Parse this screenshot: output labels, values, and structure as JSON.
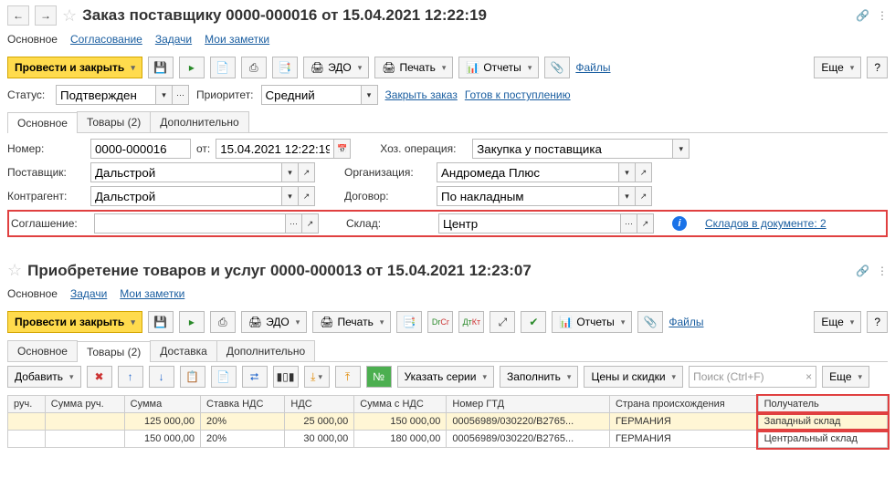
{
  "doc1": {
    "title": "Заказ поставщику 0000-000016 от 15.04.2021 12:22:19",
    "navTabs": {
      "main": "Основное",
      "approval": "Согласование",
      "tasks": "Задачи",
      "notes": "Мои заметки"
    },
    "toolbar": {
      "postClose": "Провести и закрыть",
      "edo": "ЭДО",
      "print": "Печать",
      "reports": "Отчеты",
      "files": "Файлы",
      "more": "Еще",
      "help": "?"
    },
    "status": {
      "label": "Статус:",
      "value": "Подтвержден",
      "priorityLabel": "Приоритет:",
      "priorityValue": "Средний",
      "closeOrder": "Закрыть заказ",
      "readyReceive": "Готов к поступлению"
    },
    "tabs": {
      "main": "Основное",
      "goods": "Товары (2)",
      "extra": "Дополнительно"
    },
    "fields": {
      "numberLabel": "Номер:",
      "numberValue": "0000-000016",
      "fromLabel": "от:",
      "fromValue": "15.04.2021 12:22:19",
      "opLabel": "Хоз. операция:",
      "opValue": "Закупка у поставщика",
      "supplierLabel": "Поставщик:",
      "supplierValue": "Дальстрой",
      "orgLabel": "Организация:",
      "orgValue": "Андромеда Плюс",
      "contrLabel": "Контрагент:",
      "contrValue": "Дальстрой",
      "contractLabel": "Договор:",
      "contractValue": "По накладным",
      "agreeLabel": "Соглашение:",
      "agreeValue": "",
      "warehouseLabel": "Склад:",
      "warehouseValue": "Центр",
      "warehouseInfo": "Складов в документе: 2"
    }
  },
  "doc2": {
    "title": "Приобретение товаров и услуг 0000-000013 от 15.04.2021 12:23:07",
    "navTabs": {
      "main": "Основное",
      "tasks": "Задачи",
      "notes": "Мои заметки"
    },
    "toolbar": {
      "postClose": "Провести и закрыть",
      "edo": "ЭДО",
      "print": "Печать",
      "reports": "Отчеты",
      "files": "Файлы",
      "more": "Еще",
      "help": "?"
    },
    "tabs": {
      "main": "Основное",
      "goods": "Товары (2)",
      "delivery": "Доставка",
      "extra": "Дополнительно"
    },
    "subToolbar": {
      "add": "Добавить",
      "series": "Указать серии",
      "fill": "Заполнить",
      "prices": "Цены и скидки",
      "searchPh": "Поиск (Ctrl+F)",
      "more": "Еще"
    },
    "table": {
      "headers": {
        "manual": "руч.",
        "sumManual": "Сумма руч.",
        "sum": "Сумма",
        "vatRate": "Ставка НДС",
        "vat": "НДС",
        "sumVat": "Сумма с НДС",
        "gtd": "Номер ГТД",
        "country": "Страна происхождения",
        "recipient": "Получатель"
      },
      "rows": [
        {
          "sum": "125 000,00",
          "vatRate": "20%",
          "vat": "25 000,00",
          "sumVat": "150 000,00",
          "gtd": "00056989/030220/В2765...",
          "country": "ГЕРМАНИЯ",
          "recipient": "Западный склад"
        },
        {
          "sum": "150 000,00",
          "vatRate": "20%",
          "vat": "30 000,00",
          "sumVat": "180 000,00",
          "gtd": "00056989/030220/В2765...",
          "country": "ГЕРМАНИЯ",
          "recipient": "Центральный склад"
        }
      ]
    }
  }
}
